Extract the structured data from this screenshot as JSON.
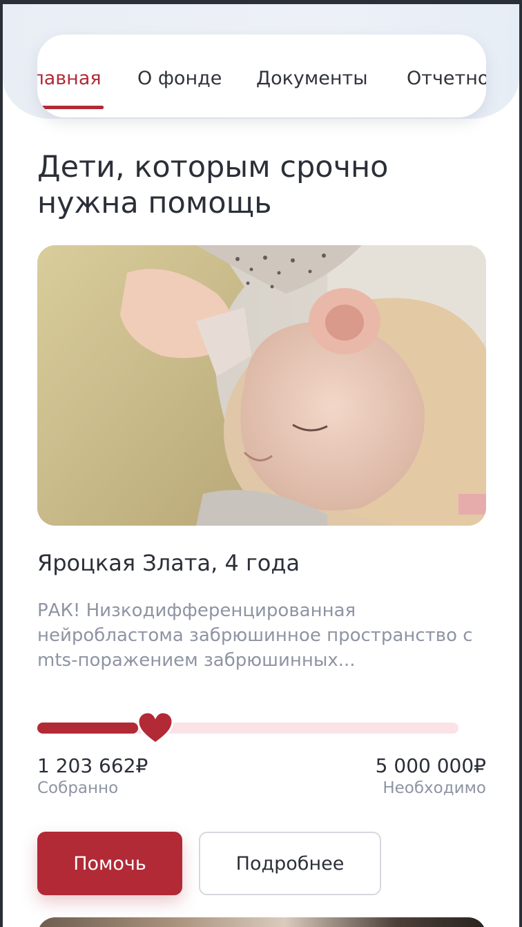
{
  "nav": {
    "items": [
      {
        "label": "Главная",
        "active": true
      },
      {
        "label": "О фонде",
        "active": false
      },
      {
        "label": "Документы",
        "active": false
      },
      {
        "label": "Отчетность",
        "active": false
      }
    ]
  },
  "section": {
    "heading": "Дети, которым срочно нужна помощь"
  },
  "card": {
    "photo_alt": "sleeping child",
    "name": "Яроцкая Злата, 4 года",
    "description": "РАК! Низкодифференцированная нейробластома забрюшинное пространство с mts-поражением забрюшинных...",
    "collected": "1 203 662₽",
    "collected_label": "Собранно",
    "needed": "5 000 000₽",
    "needed_label": "Необходимо",
    "progress_fraction": 0.24,
    "help_label": "Помочь",
    "more_label": "Подробнее"
  },
  "colors": {
    "accent": "#b12a36",
    "progress_track": "#fbe2e6",
    "muted_text": "#8e94a3",
    "text": "#2b2f38"
  },
  "icons": {
    "progress_marker": "heart-icon"
  }
}
